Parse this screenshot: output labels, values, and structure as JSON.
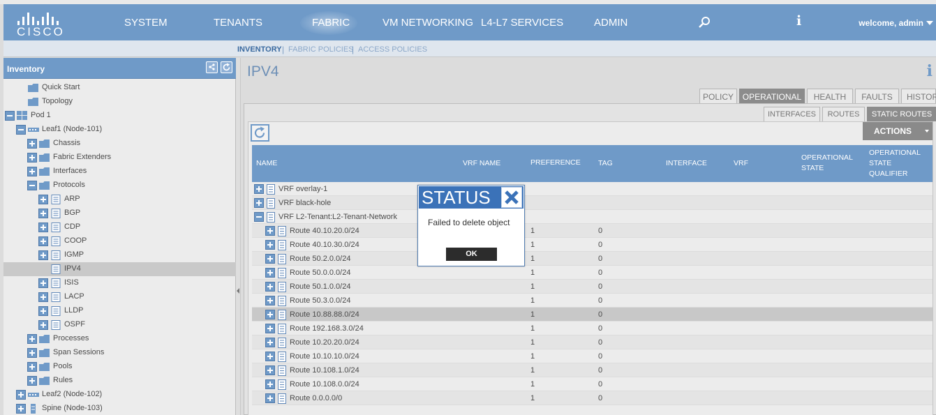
{
  "topnav": {
    "logo_text": "CISCO",
    "items": [
      "SYSTEM",
      "TENANTS",
      "FABRIC",
      "VM NETWORKING",
      "L4-L7 SERVICES",
      "ADMIN"
    ],
    "active_item": "FABRIC",
    "welcome": "welcome, admin",
    "info_glyph": "i",
    "colors": {
      "bar": "#6f9ac8",
      "text": "#ffffff"
    }
  },
  "subnav": {
    "items": [
      "INVENTORY",
      "FABRIC POLICIES",
      "ACCESS POLICIES"
    ],
    "active_item": "INVENTORY",
    "separator": "|"
  },
  "sidebar": {
    "title": "Inventory",
    "header_icons": [
      "layout-icon",
      "refresh-icon"
    ],
    "tree": [
      {
        "label": "Quick Start",
        "level": 1,
        "toggle": "none",
        "icon": "folder-icon"
      },
      {
        "label": "Topology",
        "level": 1,
        "toggle": "none",
        "icon": "folder-icon"
      },
      {
        "label": "Pod 1",
        "level": 0,
        "toggle": "minus",
        "icon": "pod-icon"
      },
      {
        "label": "Leaf1 (Node-101)",
        "level": 1,
        "toggle": "minus",
        "icon": "switch-icon"
      },
      {
        "label": "Chassis",
        "level": 2,
        "toggle": "plus",
        "icon": "folder-icon"
      },
      {
        "label": "Fabric Extenders",
        "level": 2,
        "toggle": "plus",
        "icon": "folder-icon"
      },
      {
        "label": "Interfaces",
        "level": 2,
        "toggle": "plus",
        "icon": "folder-icon"
      },
      {
        "label": "Protocols",
        "level": 2,
        "toggle": "minus",
        "icon": "folder-icon"
      },
      {
        "label": "ARP",
        "level": 3,
        "toggle": "plus",
        "icon": "document-icon"
      },
      {
        "label": "BGP",
        "level": 3,
        "toggle": "plus",
        "icon": "document-icon"
      },
      {
        "label": "CDP",
        "level": 3,
        "toggle": "plus",
        "icon": "document-icon"
      },
      {
        "label": "COOP",
        "level": 3,
        "toggle": "plus",
        "icon": "document-icon"
      },
      {
        "label": "IGMP",
        "level": 3,
        "toggle": "plus",
        "icon": "document-icon"
      },
      {
        "label": "IPV4",
        "level": 3,
        "toggle": "none",
        "icon": "document-icon",
        "selected": true
      },
      {
        "label": "ISIS",
        "level": 3,
        "toggle": "plus",
        "icon": "document-icon"
      },
      {
        "label": "LACP",
        "level": 3,
        "toggle": "plus",
        "icon": "document-icon"
      },
      {
        "label": "LLDP",
        "level": 3,
        "toggle": "plus",
        "icon": "document-icon"
      },
      {
        "label": "OSPF",
        "level": 3,
        "toggle": "plus",
        "icon": "document-icon"
      },
      {
        "label": "Processes",
        "level": 2,
        "toggle": "plus",
        "icon": "folder-icon"
      },
      {
        "label": "Span Sessions",
        "level": 2,
        "toggle": "plus",
        "icon": "folder-icon"
      },
      {
        "label": "Pools",
        "level": 2,
        "toggle": "plus",
        "icon": "folder-icon"
      },
      {
        "label": "Rules",
        "level": 2,
        "toggle": "plus",
        "icon": "folder-icon"
      },
      {
        "label": "Leaf2 (Node-102)",
        "level": 1,
        "toggle": "plus",
        "icon": "switch-icon"
      },
      {
        "label": "Spine (Node-103)",
        "level": 1,
        "toggle": "plus",
        "icon": "spine-icon"
      }
    ]
  },
  "main": {
    "title": "IPV4",
    "info_glyph": "i",
    "tabs": [
      "POLICY",
      "OPERATIONAL",
      "HEALTH",
      "FAULTS",
      "HISTORY"
    ],
    "active_tab": "OPERATIONAL",
    "subtabs": [
      "INTERFACES",
      "ROUTES",
      "STATIC ROUTES"
    ],
    "active_subtab": "STATIC ROUTES",
    "actions_label": "ACTIONS",
    "table": {
      "columns": [
        "NAME",
        "VRF NAME",
        "PREFERENCE",
        "TAG",
        "INTERFACE",
        "VRF",
        "OPERATIONAL STATE",
        "OPERATIONAL STATE QUALIFIER"
      ],
      "rows": [
        {
          "name": "VRF overlay-1",
          "level": 0,
          "toggle": "plus",
          "preference": "",
          "tag": ""
        },
        {
          "name": "VRF black-hole",
          "level": 0,
          "toggle": "plus",
          "preference": "",
          "tag": ""
        },
        {
          "name": "VRF L2-Tenant:L2-Tenant-Network",
          "level": 0,
          "toggle": "minus",
          "preference": "",
          "tag": ""
        },
        {
          "name": "Route 40.10.20.0/24",
          "level": 1,
          "toggle": "plus",
          "preference": "1",
          "tag": "0"
        },
        {
          "name": "Route 40.10.30.0/24",
          "level": 1,
          "toggle": "plus",
          "preference": "1",
          "tag": "0"
        },
        {
          "name": "Route 50.2.0.0/24",
          "level": 1,
          "toggle": "plus",
          "preference": "1",
          "tag": "0"
        },
        {
          "name": "Route 50.0.0.0/24",
          "level": 1,
          "toggle": "plus",
          "preference": "1",
          "tag": "0"
        },
        {
          "name": "Route 50.1.0.0/24",
          "level": 1,
          "toggle": "plus",
          "preference": "1",
          "tag": "0"
        },
        {
          "name": "Route 50.3.0.0/24",
          "level": 1,
          "toggle": "plus",
          "preference": "1",
          "tag": "0"
        },
        {
          "name": "Route 10.88.88.0/24",
          "level": 1,
          "toggle": "plus",
          "preference": "1",
          "tag": "0",
          "highlighted": true
        },
        {
          "name": "Route 192.168.3.0/24",
          "level": 1,
          "toggle": "plus",
          "preference": "1",
          "tag": "0"
        },
        {
          "name": "Route 10.20.20.0/24",
          "level": 1,
          "toggle": "plus",
          "preference": "1",
          "tag": "0"
        },
        {
          "name": "Route 10.10.10.0/24",
          "level": 1,
          "toggle": "plus",
          "preference": "1",
          "tag": "0"
        },
        {
          "name": "Route 10.108.1.0/24",
          "level": 1,
          "toggle": "plus",
          "preference": "1",
          "tag": "0"
        },
        {
          "name": "Route 10.108.0.0/24",
          "level": 1,
          "toggle": "plus",
          "preference": "1",
          "tag": "0"
        },
        {
          "name": "Route 0.0.0.0/0",
          "level": 1,
          "toggle": "plus",
          "preference": "1",
          "tag": "0"
        }
      ]
    }
  },
  "modal": {
    "title": "STATUS",
    "message": "Failed to delete object",
    "ok_label": "OK",
    "close_icon": "close-icon"
  }
}
